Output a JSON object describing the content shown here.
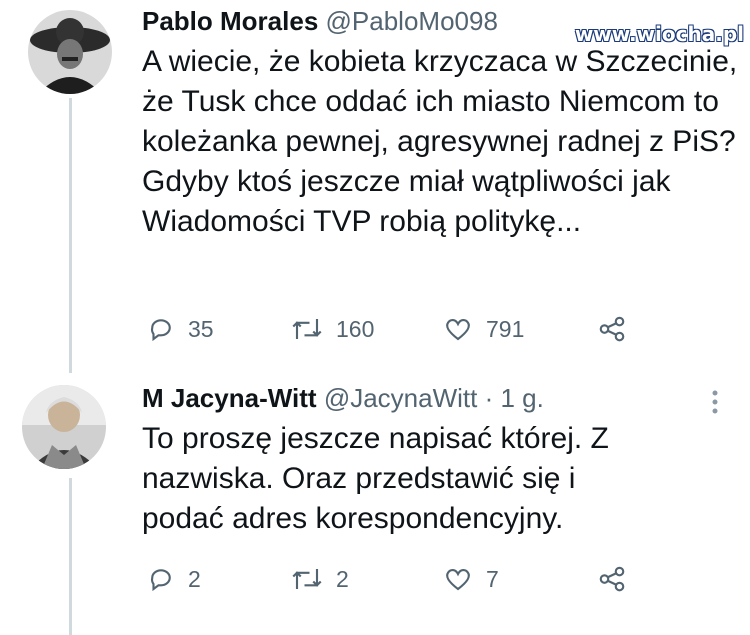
{
  "tweet1": {
    "name": "Pablo Morales",
    "handle": "@PabloMo098",
    "text": "A wiecie, że kobieta krzyczaca w Szczecinie, że Tusk chce oddać ich miasto Niemcom to koleżanka pewnej, agresywnej radnej z PiS? Gdyby ktoś jeszcze miał wątpliwości jak Wiadomości TVP robią politykę...",
    "replies": "35",
    "retweets": "160",
    "likes": "791"
  },
  "tweet2": {
    "name": "M Jacyna-Witt",
    "handle": "@JacynaWitt · 1 g.",
    "text": "To proszę jeszcze napisać której. Z nazwiska. Oraz przedstawić się i podać adres korespondencyjny.",
    "replies": "2",
    "retweets": "2",
    "likes": "7"
  },
  "watermark": "www.wiocha.pl",
  "icons": [
    "reply-icon",
    "retweet-icon",
    "like-icon",
    "share-icon",
    "more-icon"
  ],
  "colors": {
    "text": "#0f1419",
    "muted": "#536471",
    "thread": "#cfd9de"
  }
}
